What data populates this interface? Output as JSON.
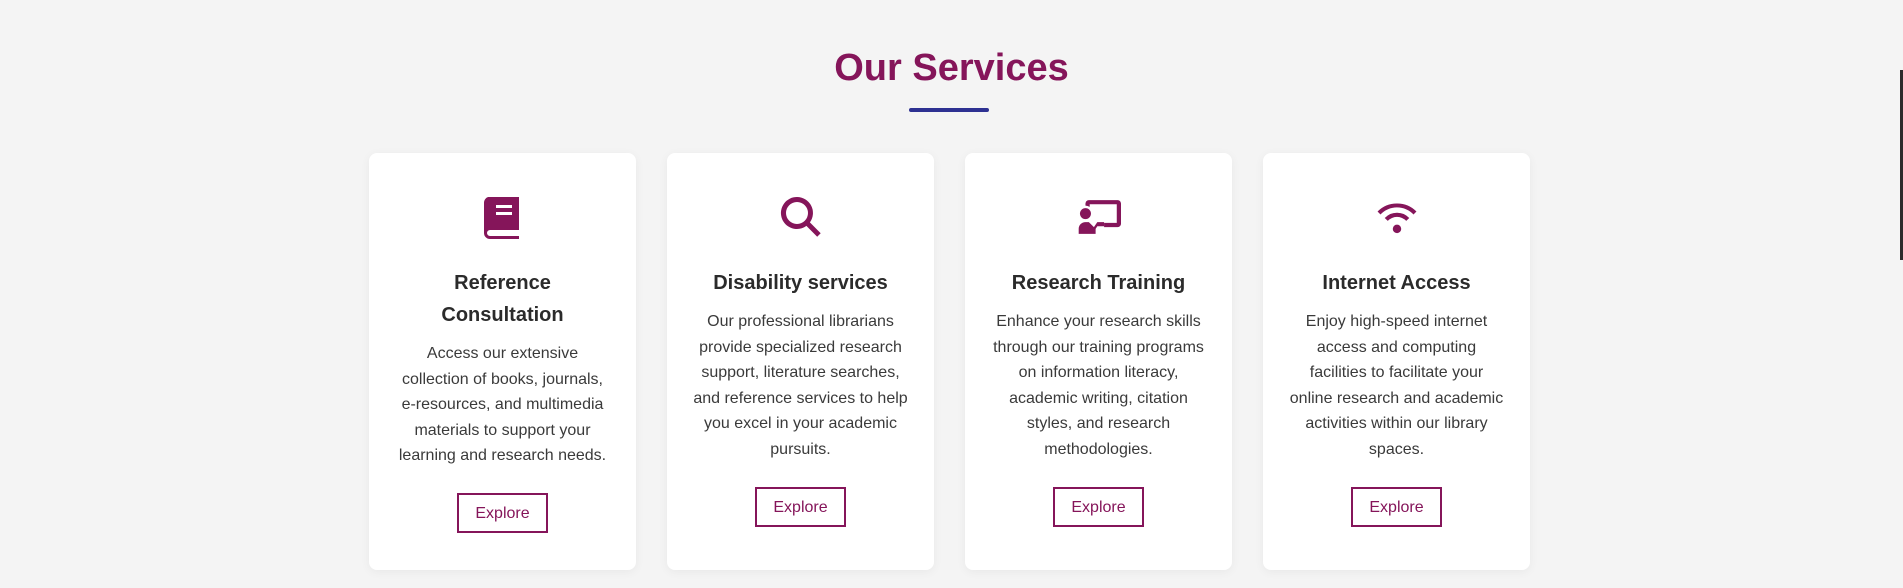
{
  "section": {
    "title": "Our Services"
  },
  "colors": {
    "accent": "#85155a",
    "underline": "#2e3192",
    "background": "#f4f4f4",
    "card": "#ffffff"
  },
  "services": [
    {
      "icon": "book-icon",
      "title": "Reference Consultation",
      "description": "Access our extensive collection of books, journals, e-resources, and multimedia materials to support your learning and research needs.",
      "button": "Explore"
    },
    {
      "icon": "search-icon",
      "title": "Disability services",
      "description": "Our professional librarians provide specialized research support, literature searches, and reference services to help you excel in your academic pursuits.",
      "button": "Explore"
    },
    {
      "icon": "chalkboard-teacher-icon",
      "title": "Research Training",
      "description": "Enhance your research skills through our training programs on information literacy, academic writing, citation styles, and research methodologies.",
      "button": "Explore"
    },
    {
      "icon": "wifi-icon",
      "title": "Internet Access",
      "description": "Enjoy high-speed internet access and computing facilities to facilitate your online research and academic activities within our library spaces.",
      "button": "Explore"
    }
  ]
}
